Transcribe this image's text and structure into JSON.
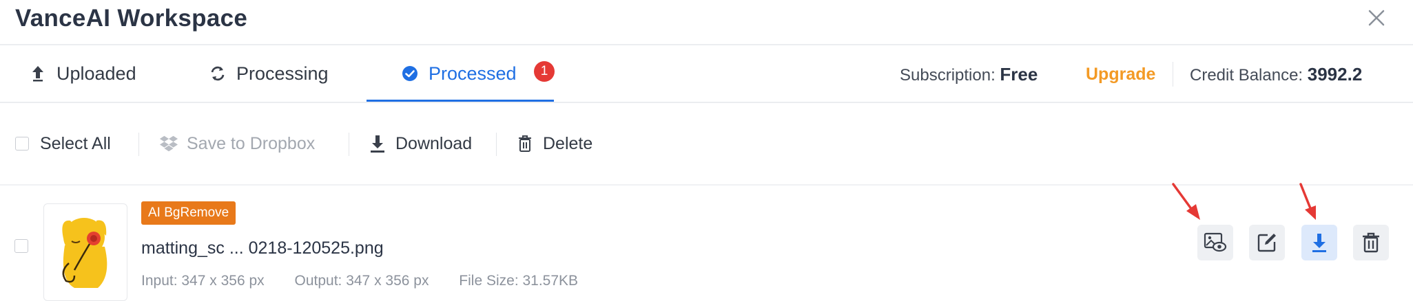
{
  "window": {
    "title": "VanceAI Workspace"
  },
  "tabs": [
    {
      "label": "Uploaded",
      "icon": "arrow-up-icon",
      "active": false
    },
    {
      "label": "Processing",
      "icon": "refresh-icon",
      "active": false
    },
    {
      "label": "Processed",
      "icon": "check-circle-icon",
      "active": true,
      "badge": "1"
    }
  ],
  "account": {
    "subscription_label": "Subscription:",
    "subscription_value": "Free",
    "upgrade_label": "Upgrade",
    "credit_label": "Credit Balance:",
    "credit_value": "3992.2"
  },
  "toolbar": {
    "select_all": "Select All",
    "save_dropbox": "Save to Dropbox",
    "download": "Download",
    "delete": "Delete"
  },
  "files": [
    {
      "tag": "AI BgRemove",
      "name": "matting_sc ... 0218-120525.png",
      "input": "Input: 347 x 356 px",
      "output": "Output: 347 x 356 px",
      "size": "File Size: 31.57KB"
    }
  ],
  "colors": {
    "accent": "#1f6fe3",
    "badge": "#e53935",
    "upgrade": "#f39a25",
    "tag": "#e8791a",
    "annotation_arrow": "#e53935"
  }
}
